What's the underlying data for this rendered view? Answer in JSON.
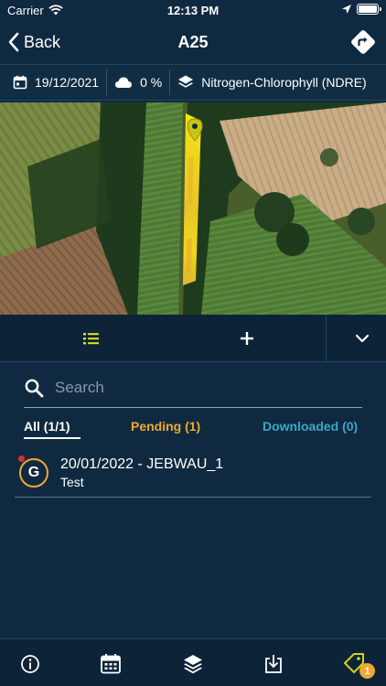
{
  "status_bar": {
    "carrier": "Carrier",
    "time": "12:13 PM"
  },
  "nav": {
    "back_label": "Back",
    "title": "A25"
  },
  "info_bar": {
    "date": "19/12/2021",
    "cloud": "0 %",
    "layer": "Nitrogen-Chlorophyll (NDRE)"
  },
  "search": {
    "placeholder": "Search"
  },
  "tabs": {
    "all": "All (1/1)",
    "pending": "Pending (1)",
    "downloaded": "Downloaded (0)"
  },
  "list": {
    "items": [
      {
        "avatar": "G",
        "title": "20/01/2022 - JEBWAU_1",
        "subtitle": "Test"
      }
    ]
  },
  "bottom_bar": {
    "tags_badge": "1"
  },
  "icons": {
    "status": [
      "wifi-icon",
      "location-arrow-icon",
      "battery-icon"
    ],
    "nav": [
      "chevron-left-icon",
      "directions-icon"
    ],
    "info": [
      "calendar-icon",
      "cloud-icon",
      "layers-icon"
    ],
    "toolbar": [
      "list-icon",
      "plus-icon",
      "chevron-down-icon"
    ],
    "bottom": [
      "info-icon",
      "calendar-grid-icon",
      "layers-icon",
      "download-icon",
      "tag-icon"
    ]
  },
  "colors": {
    "background": "#0f2a40",
    "accent_yellow": "#e6e02a",
    "pending": "#f0a830",
    "downloaded": "#3aa6c8",
    "notification_dot": "#e32b2b"
  }
}
